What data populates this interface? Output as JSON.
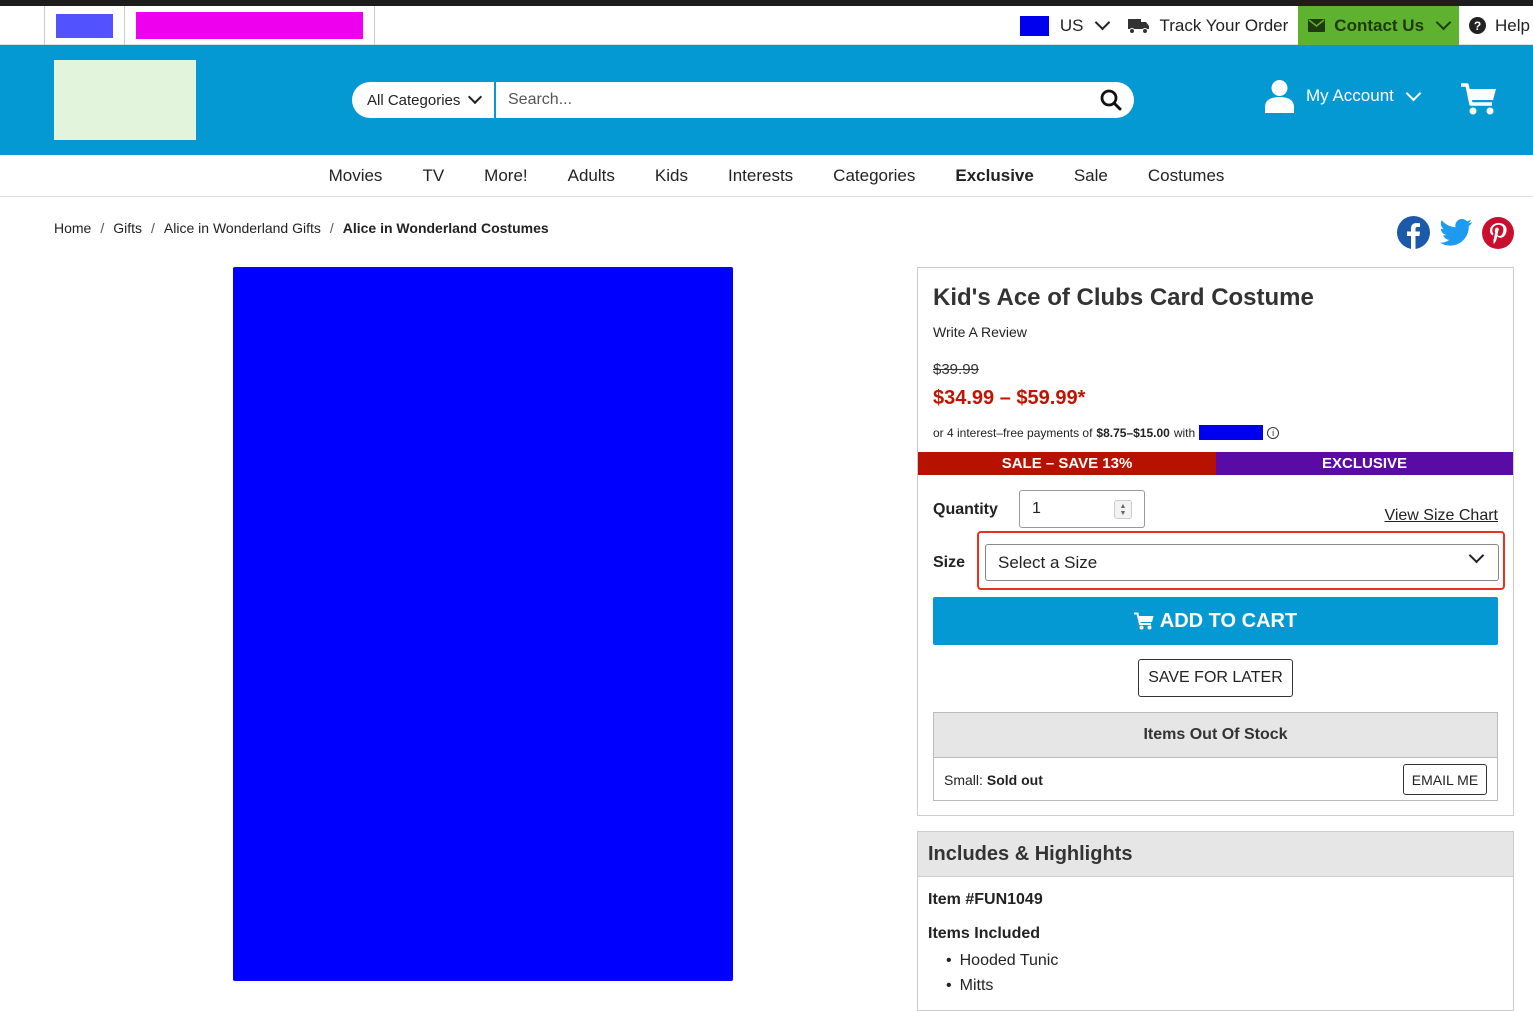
{
  "util": {
    "country": "US",
    "track_order": "Track Your Order",
    "contact": "Contact Us",
    "help": "Help"
  },
  "search": {
    "category": "All Categories",
    "placeholder": "Search..."
  },
  "account": {
    "label": "My Account"
  },
  "nav": {
    "items": [
      "Movies",
      "TV",
      "More!",
      "Adults",
      "Kids",
      "Interests",
      "Categories",
      "Exclusive",
      "Sale",
      "Costumes"
    ]
  },
  "breadcrumb": {
    "home": "Home",
    "gifts": "Gifts",
    "alice_gifts": "Alice in Wonderland Gifts",
    "current": "Alice in Wonderland Costumes",
    "separator": "/"
  },
  "product": {
    "title": "Kid's Ace of Clubs Card Costume",
    "review_link": "Write A Review",
    "old_price": "$39.99",
    "price": "$34.99 – $59.99*",
    "installments_prefix": "or 4 interest–free payments of",
    "installments_amount": "$8.75–$15.00",
    "installments_suffix": "with",
    "badge_sale": "SALE – SAVE 13%",
    "badge_exclusive": "EXCLUSIVE",
    "quantity_label": "Quantity",
    "quantity_value": "1",
    "size_chart": "View Size Chart",
    "size_label": "Size",
    "size_select": "Select a Size",
    "add_to_cart": "ADD TO CART",
    "save_for_later": "SAVE FOR LATER",
    "oos_heading": "Items Out Of Stock",
    "oos_size": "Small:",
    "oos_status": "Sold out",
    "email_me": "EMAIL ME"
  },
  "highlights": {
    "heading": "Includes & Highlights",
    "item_number": "Item #FUN1049",
    "included_heading": "Items Included",
    "included": [
      "Hooded Tunic",
      "Mitts"
    ]
  },
  "colors": {
    "brand_blue": "#0599d4",
    "sale_red": "#b71200",
    "exclusive_purple": "#5a0aa5",
    "contact_green": "#5fb130"
  }
}
